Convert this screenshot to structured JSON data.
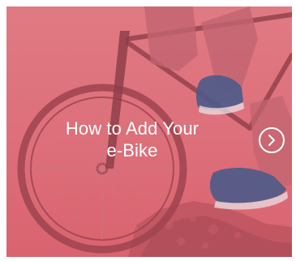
{
  "card": {
    "title": "How to Add Your\ne-Bike",
    "action_icon": "chevron-right-circle-icon",
    "overlay_color": "#dd6f7a",
    "text_color": "#ffffff"
  }
}
